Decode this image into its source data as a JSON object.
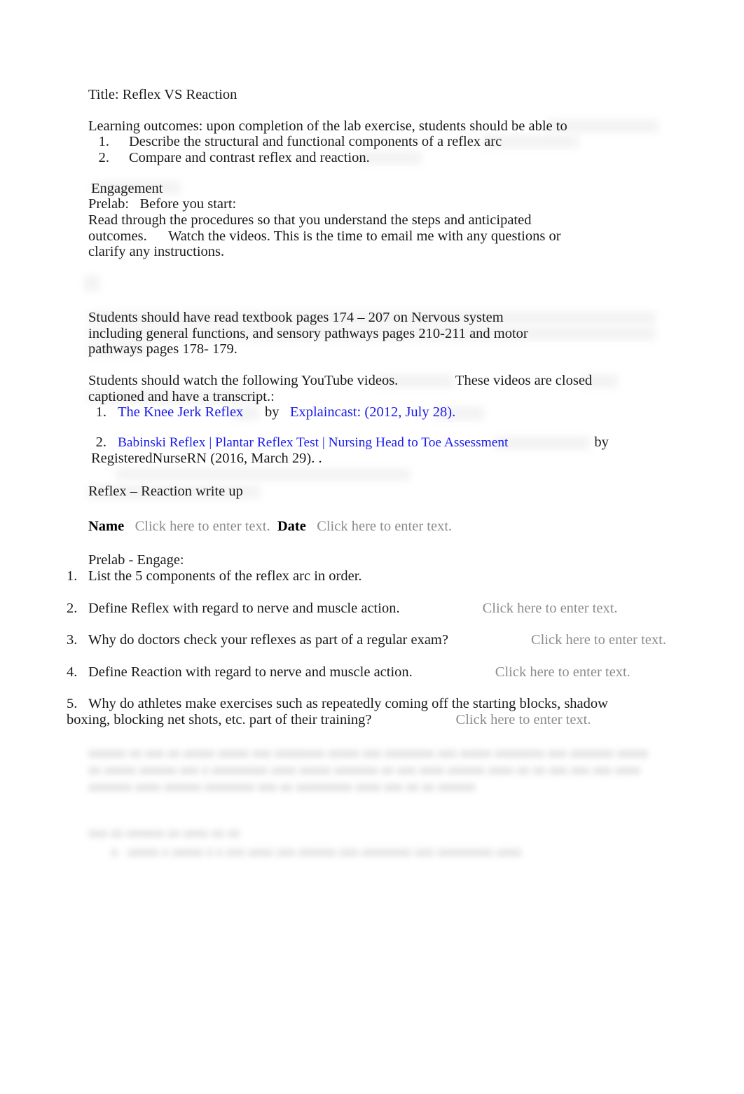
{
  "document": {
    "title_line": "Title: Reflex VS Reaction",
    "learning_outcomes_intro": "Learning outcomes: upon completion of the lab exercise, students should be able to",
    "learning_outcomes": [
      {
        "num": "1.",
        "text": "Describe the structural and functional components of a reflex arc"
      },
      {
        "num": "2.",
        "text": "Compare and contrast reflex and reaction."
      }
    ],
    "engagement_heading": "Engagement",
    "prelab_line": "Prelab:   Before you start:",
    "read_through": "Read through the procedures so that you understand the steps and anticipated outcomes.      Watch the videos. This is the time to email me with any questions or clarify any instructions.",
    "textbook_note": "Students should have read textbook pages 174 – 207 on Nervous system including general functions, and sensory pathways pages 210-211 and motor pathways pages 178- 179.",
    "youtube_note": "Students should watch the following YouTube videos.                These videos are closed captioned and have a transcript.:",
    "videos": [
      {
        "num": "1.",
        "link": "The Knee Jerk Reflex",
        "by": "by",
        "source_link": "Explaincast: (2012, July 28).",
        "trailing": ""
      },
      {
        "num": "2.",
        "link": "Babinski Reflex | Plantar Reflex Test | Nursing Head to Toe Assessment",
        "by": "by",
        "source_link": "",
        "trailing": "RegisteredNurseRN (2016, March 29).                 ."
      }
    ],
    "writeup_heading": "Reflex – Reaction write up",
    "name_label": "Name",
    "name_placeholder": "Click here to enter text.",
    "date_label": "Date",
    "date_placeholder": "Click here to enter text.",
    "prelab_engage_heading": "Prelab - Engage:",
    "questions": [
      {
        "num": "1.",
        "text": "List the 5 components of the reflex arc in order.",
        "placeholder": ""
      },
      {
        "num": "2.",
        "text": "Define Reflex with regard to nerve and muscle action.",
        "placeholder": "Click here to enter text."
      },
      {
        "num": "3.",
        "text": "Why do doctors check your reflexes as part of a regular exam?",
        "placeholder": "Click here to enter text."
      },
      {
        "num": "4.",
        "text": "Define Reaction with regard to nerve and muscle action.",
        "placeholder": "Click here to enter text."
      },
      {
        "num": "5.",
        "text": "Why do athletes make exercises such as repeatedly coming off the starting blocks, shadow boxing, blocking net shots, etc. part of their training?",
        "placeholder": "Click here to enter text."
      }
    ],
    "redacted_paragraph": "aaaaaa aa aaa aa aaaaa aaaaa aaa aaaaaaaa aaaaa aaa aaaaaaaa aaa aaaaa aaaaaaaa aaa aaaaaaa aaaaa aa aaaaa aaaaaa aaa a aaaaaaaaa aaaa aaaaa aaaaaaa aa aaa aaaa aaaaaa aaaa aa aa aaa aaa aaa aaaa aaaaaaa aaaa aaaaaa aaaaaaaa aaa aa aaaaaaaaa aaaa aaa aa aa aaaaaa",
    "redacted_heading": "aaa aa aaaaaa aa aaaa aa aa",
    "redacted_item": "a.  aaaaa a aaaaa a a aaa aaaa aaa aaaaaa aaa aaaaaaaa aaa aaaaaaaaa aaaa"
  },
  "colors": {
    "link": "#1a1aee",
    "placeholder": "#8c8c8c",
    "text": "#1a1a1a",
    "page_background": "#ffffff"
  }
}
